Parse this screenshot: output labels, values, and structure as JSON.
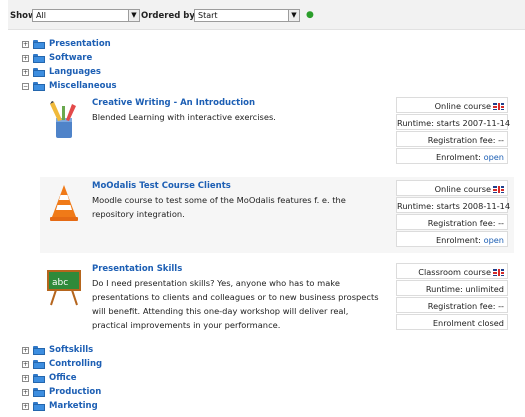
{
  "filters": {
    "show_label": "Show",
    "show_value": "All",
    "order_label": "Ordered by",
    "order_value": "Start"
  },
  "categories_top": [
    {
      "label": "Presentation",
      "state": "+"
    },
    {
      "label": "Software",
      "state": "+"
    },
    {
      "label": "Languages",
      "state": "+"
    },
    {
      "label": "Miscellaneous",
      "state": "−"
    }
  ],
  "courses": [
    {
      "title": "Creative Writing - An Introduction",
      "desc": "Blended Learning with interactive exercises.",
      "type": "Online course",
      "runtime": "Runtime: starts 2007-11-14",
      "fee": "Registration fee: --",
      "enrol_label": "Enrolment:",
      "enrol_status": "open"
    },
    {
      "title": "MoOdalis Test Course Clients",
      "desc": "Moodle course to test some of the MoOdalis features f. e. the repository integration.",
      "type": "Online course",
      "runtime": "Runtime: starts 2008-11-14",
      "fee": "Registration fee: --",
      "enrol_label": "Enrolment:",
      "enrol_status": "open"
    },
    {
      "title": "Presentation Skills",
      "desc": "Do I need presentation skills? Yes, anyone who has to make presentations to clients and colleagues or to new business prospects will benefit. Attending this one-day workshop will deliver real, practical improvements in your performance.",
      "type": "Classroom course",
      "runtime": "Runtime: unlimited",
      "fee": "Registration fee: --",
      "enrol_label": "Enrolment closed",
      "enrol_status": ""
    }
  ],
  "categories_bottom": [
    {
      "label": "Softskills",
      "state": "+"
    },
    {
      "label": "Controlling",
      "state": "+"
    },
    {
      "label": "Office",
      "state": "+"
    },
    {
      "label": "Production",
      "state": "+"
    },
    {
      "label": "Marketing",
      "state": "+"
    }
  ],
  "icons": {
    "folder": "folder-icon",
    "course1": "pencil-cup-icon",
    "course2": "traffic-cone-icon",
    "course3": "abc-easel-icon",
    "flag": "uk-flag-icon"
  },
  "colors": {
    "link": "#1d5fb4",
    "folder": "#3d8ee0"
  }
}
